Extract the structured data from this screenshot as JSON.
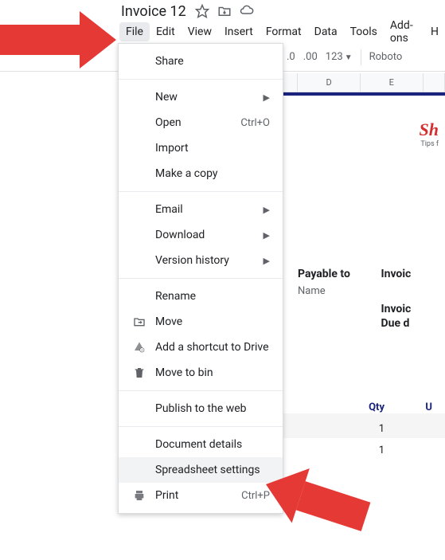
{
  "doc_title": "Invoice 12",
  "menubar": {
    "file": "File",
    "edit": "Edit",
    "view": "View",
    "insert": "Insert",
    "format": "Format",
    "data": "Data",
    "tools": "Tools",
    "addons": "Add-ons",
    "help": "H"
  },
  "toolbar": {
    "dec0": ".0",
    "dec00": ".00",
    "numfmt": "123",
    "font": "Roboto"
  },
  "file_menu": {
    "share": "Share",
    "new": "New",
    "open": "Open",
    "open_shortcut": "Ctrl+O",
    "import": "Import",
    "make_copy": "Make a copy",
    "email": "Email",
    "download": "Download",
    "version_history": "Version history",
    "rename": "Rename",
    "move": "Move",
    "add_shortcut": "Add a shortcut to Drive",
    "move_to_bin": "Move to bin",
    "publish": "Publish to the web",
    "document_details": "Document details",
    "spreadsheet_settings": "Spreadsheet settings",
    "print": "Print",
    "print_shortcut": "Ctrl+P"
  },
  "columns": {
    "d": "D",
    "e": "E"
  },
  "sheet": {
    "brand": "Sh",
    "brand_sub": "Tips f",
    "payable_to": "Payable to",
    "payable_name": "Name",
    "invoice_label": "Invoic",
    "invoice_label2": "Invoic",
    "due_label": "Due d",
    "qty_header": "Qty",
    "u_header": "U",
    "row1_qty": "1",
    "row2_qty": "1"
  }
}
